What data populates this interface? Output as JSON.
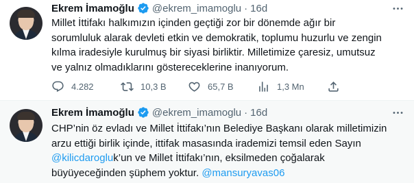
{
  "tweets": [
    {
      "author_name": "Ekrem İmamoğlu",
      "handle": "@ekrem_imamoglu",
      "separator": "·",
      "time": "16d",
      "lines": [
        "Millet İttifakı halkımızın içinden geçtiği zor bir dönemde ağır bir",
        "sorumluluk alarak devleti etkin ve demokratik, toplumu huzurlu ve zengin",
        "kılma iradesiyle kurulmuş bir siyasi birliktir. Milletimize çaresiz, umutsuz",
        "ve yalnız olmadıklarını göstereceklerine inanıyorum."
      ],
      "stats": {
        "replies": "4.282",
        "retweets": "10,3 B",
        "likes": "65,7 B",
        "views": "1,3 Mn"
      }
    },
    {
      "author_name": "Ekrem İmamoğlu",
      "handle": "@ekrem_imamoglu",
      "separator": "·",
      "time": "16d",
      "line1": "CHP’nin öz evladı ve Millet İttifakı’nın Belediye Başkanı olarak milletimizin",
      "line2": "arzu ettiği birlik içinde, ittifak masasında irademizi temsil eden Sayın",
      "line3_mention": "@kilicdaroglu",
      "line3_rest": "k’un ve Millet İttifakı’nın, eksilmeden çoğalarak",
      "line4_text": "büyüyeceğinden şüphem yoktur. ",
      "line4_mention": "@mansuryavas06"
    }
  ],
  "icons": {
    "verified": "verified-badge-icon",
    "more": "more-options-icon",
    "reply": "reply-icon",
    "retweet": "retweet-icon",
    "like": "heart-icon",
    "views": "views-icon",
    "share": "share-icon"
  },
  "colors": {
    "accent": "#1d9bf0",
    "muted_text": "#536471",
    "primary_text": "#0f1419"
  }
}
